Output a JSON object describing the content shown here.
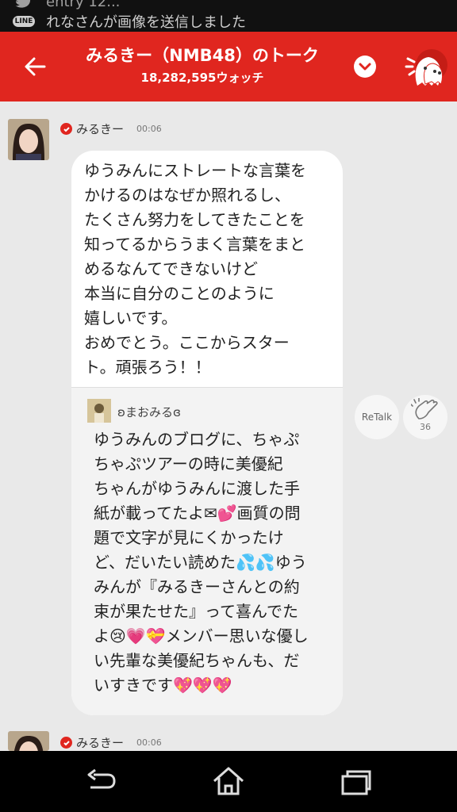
{
  "status_bar": {
    "notifications": [
      {
        "app_icon": "twitter-icon",
        "text": "entry 12..."
      },
      {
        "app_icon": "line-icon",
        "badge": "LINE",
        "text": "れなさんが画像を送信しました"
      }
    ]
  },
  "header": {
    "title": "みるきー（NMB48）のトーク",
    "subtitle": "18,282,595ウォッチ",
    "back_icon": "arrow-left-icon",
    "dropdown_icon": "chevron-down-icon",
    "mascot_icon": "ghost-mascot-icon"
  },
  "messages": [
    {
      "sender": "みるきー",
      "time": "00:06",
      "verified": true,
      "text": "ゆうみんにストレートな言葉を\nかけるのはなぜか照れるし、\nたくさん努力をしてきたことを\n知ってるからうまく言葉をまと\nめるなんてできないけど\n本当に自分のことのように\n嬉しいです。\nおめでとう。ここからスター\nト。頑張ろう！！",
      "quote": {
        "name": "ʚまおみるɞ",
        "text": "ゆうみんのブログに、ちゃぷ\nちゃぷツアーの時に美優紀\nちゃんがゆうみんに渡した手\n紙が載ってたよ✉💕画質の問\n題で文字が見にくかったけ\nど、だいたい読めた💦💦ゆう\nみんが『みるきーさんとの約\n束が果たせた』って喜んでた\nよ😢💗💝メンバー思いな優し\nい先輩な美優紀ちゃんも、だ\nいすきです💖💖💖"
      },
      "retalk_label": "ReTalk",
      "clap_count": "36"
    },
    {
      "sender": "みるきー",
      "time": "00:06",
      "verified": true
    }
  ],
  "nav": {
    "back_icon": "nav-back-icon",
    "home_icon": "nav-home-icon",
    "recents_icon": "nav-recents-icon"
  },
  "colors": {
    "accent": "#e0261f",
    "background": "#e9e9e9",
    "bubble": "#ffffff",
    "quote": "#f3f3f3"
  }
}
